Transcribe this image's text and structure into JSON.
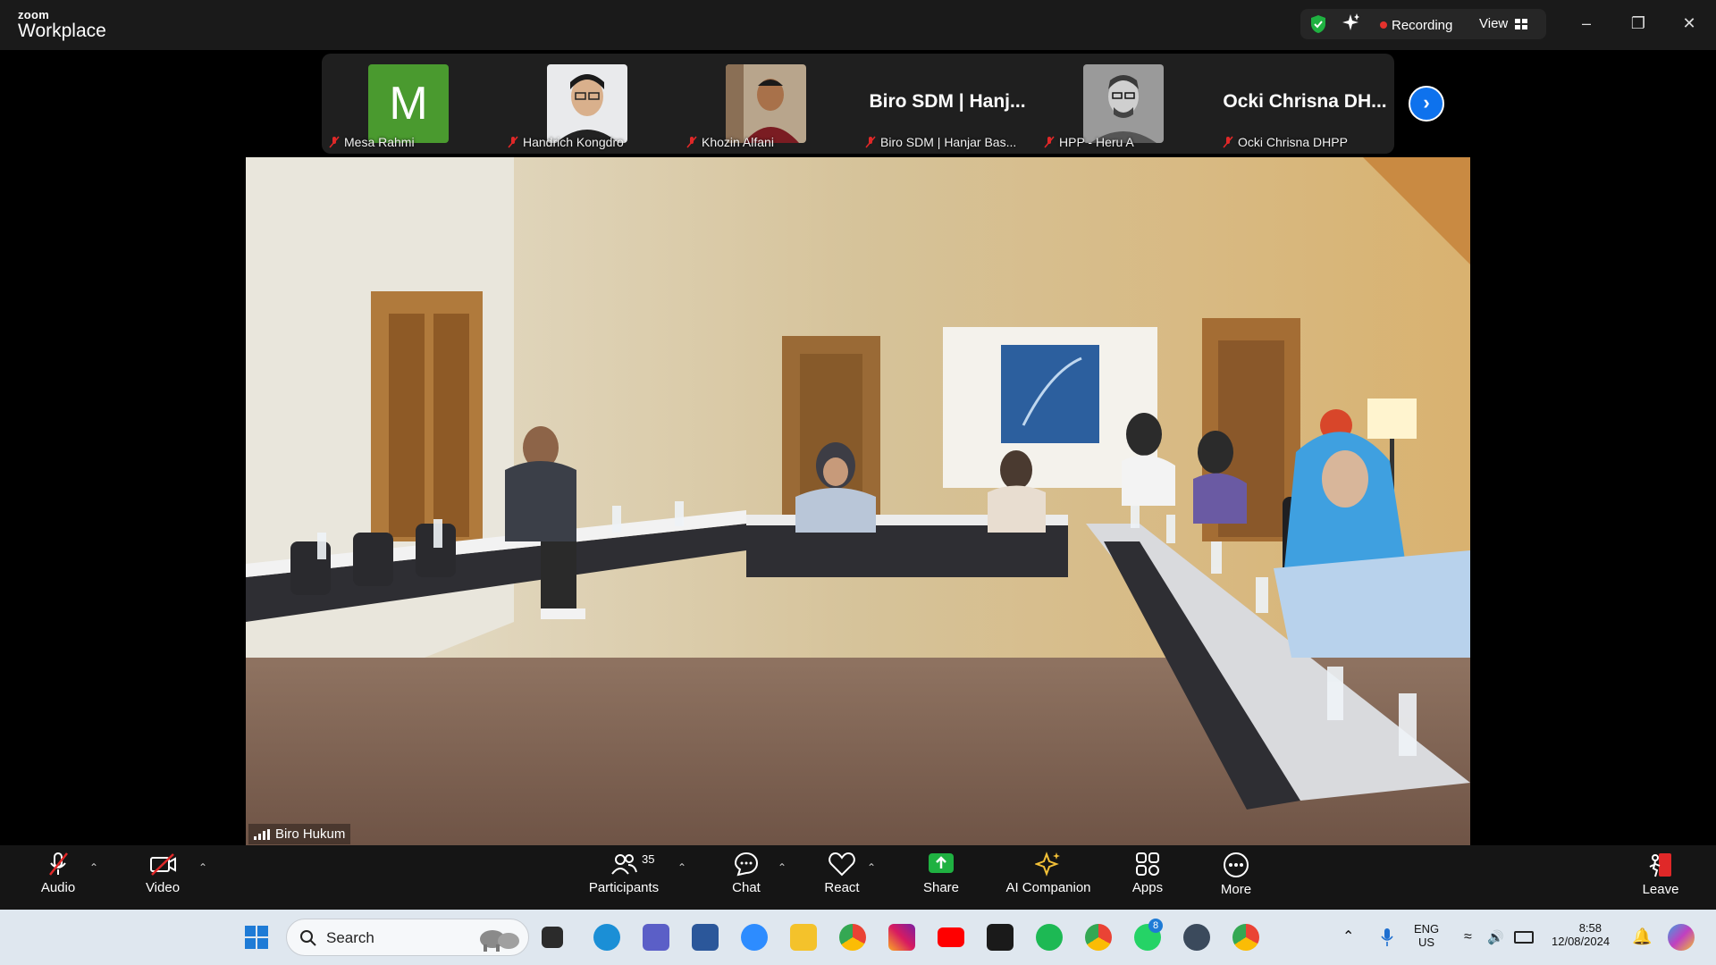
{
  "app": {
    "brand_top": "zoom",
    "brand_bottom": "Workplace"
  },
  "titlebar": {
    "recording_label": "Recording",
    "view_label": "View"
  },
  "thumbnails": [
    {
      "name": "Mesa Rahmi",
      "avatar_letter": "M",
      "avatar_color": "#4a9a2f"
    },
    {
      "name": "Handrich Kongdro"
    },
    {
      "name": "Khozin Alfani"
    },
    {
      "name": "Biro SDM | Hanjar Bas...",
      "big_name": "Biro SDM | Hanj..."
    },
    {
      "name": "HPP - Heru A"
    },
    {
      "name": "Ocki Chrisna DHPP",
      "big_name": "Ocki Chrisna DH..."
    }
  ],
  "main_video": {
    "label": "Biro Hukum"
  },
  "toolbar": {
    "audio": "Audio",
    "video": "Video",
    "participants": "Participants",
    "participants_count": "35",
    "chat": "Chat",
    "react": "React",
    "share": "Share",
    "ai_companion": "AI Companion",
    "apps": "Apps",
    "more": "More",
    "leave": "Leave",
    "share_color": "#1fb141",
    "leave_color": "#e02828"
  },
  "taskbar": {
    "search_placeholder": "Search",
    "lang_top": "ENG",
    "lang_bottom": "US",
    "time": "8:58",
    "date": "12/08/2024",
    "whatsapp_badge": "8"
  }
}
